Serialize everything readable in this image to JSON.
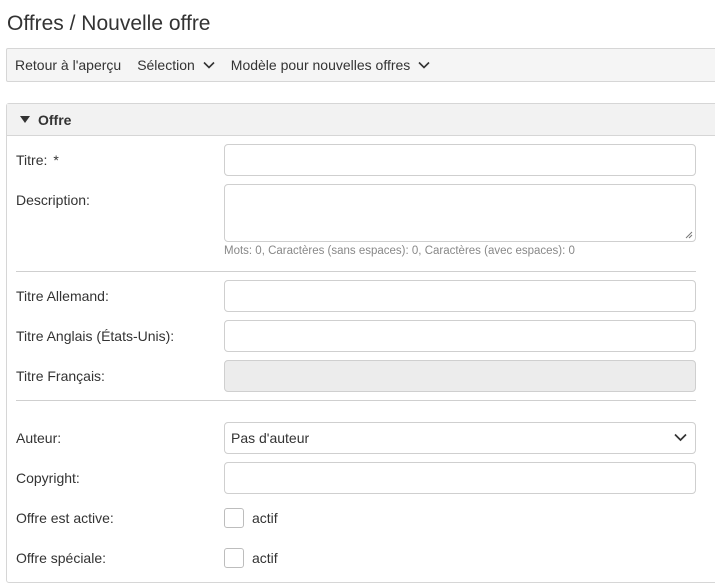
{
  "header": {
    "title": "Offres / Nouvelle offre"
  },
  "toolbar": {
    "back_label": "Retour à l'aperçu",
    "selection_label": "Sélection",
    "template_label": "Modèle pour nouvelles offres"
  },
  "panel": {
    "title": "Offre"
  },
  "form": {
    "title_label": "Titre:",
    "required_mark": "*",
    "title_value": "",
    "description_label": "Description:",
    "description_value": "",
    "counter_text": "Mots: 0, Caractères (sans espaces): 0, Caractères (avec espaces): 0",
    "title_de_label": "Titre Allemand:",
    "title_de_value": "",
    "title_en_label": "Titre Anglais (États-Unis):",
    "title_en_value": "",
    "title_fr_label": "Titre Français:",
    "title_fr_value": "",
    "author_label": "Auteur:",
    "author_value": "Pas d'auteur",
    "copyright_label": "Copyright:",
    "copyright_value": "",
    "active_label": "Offre est active:",
    "active_checkbox_label": "actif",
    "active_checked": false,
    "special_label": "Offre spéciale:",
    "special_checkbox_label": "actif",
    "special_checked": false
  },
  "icons": {
    "chevron": "chevron-down-icon",
    "triangle": "triangle-down-icon"
  },
  "colors": {
    "toolbar_bg": "#f5f5f5",
    "border": "#d6d6d6",
    "disabled_bg": "#ececec",
    "muted_text": "#888888"
  }
}
